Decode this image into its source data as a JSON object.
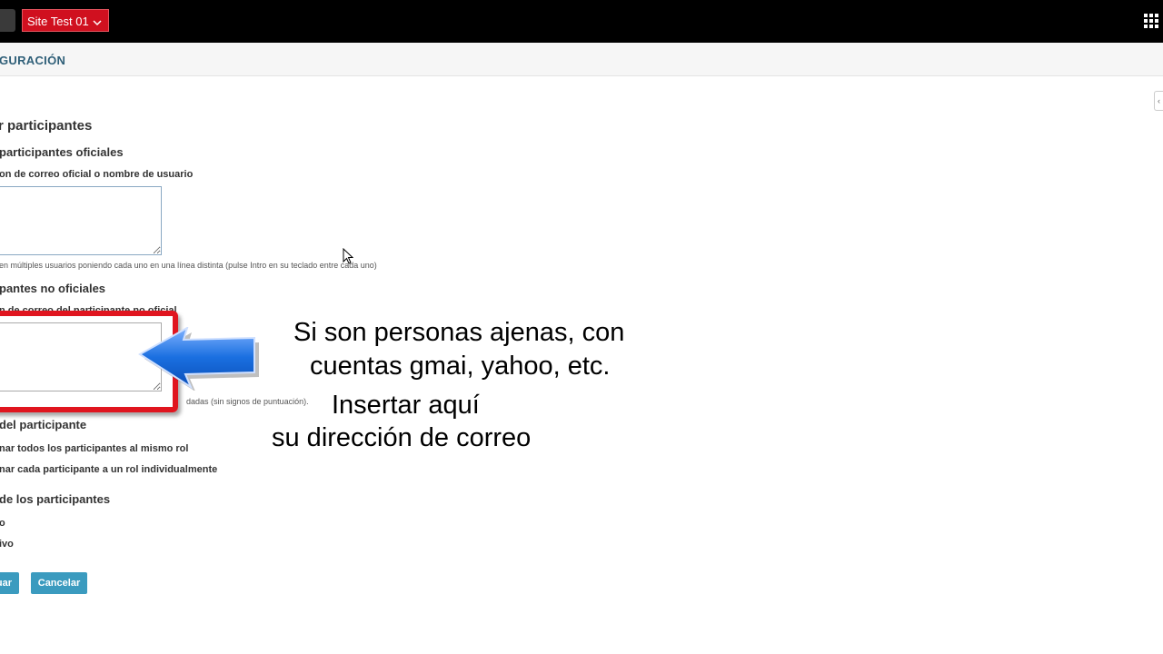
{
  "topbar": {
    "site_label": "Site Test 01",
    "site_chevron_icon": "chevron-down-icon",
    "apps_icon": "grid-icon"
  },
  "subbar": {
    "title": "GURACIÓN"
  },
  "side_toggle_glyph": "‹",
  "form": {
    "heading": "r participantes",
    "official": {
      "heading": "participantes oficiales",
      "label": "on de correo oficial o nombre de usuario",
      "help": "en múltiples usuarios poniendo cada uno en una línea distinta (pulse Intro en su teclado entre cada uno)",
      "value": ""
    },
    "unofficial": {
      "heading": "pantes no oficiales",
      "label": "n de correo del participante no oficial",
      "help": "dadas (sin signos de puntuación).",
      "value": ""
    },
    "role": {
      "heading": "del participante",
      "option_same": "nar todos los participantes al mismo rol",
      "option_individual": "nar cada participante a un rol individualmente"
    },
    "status": {
      "heading": "de los participantes",
      "option_active": "o",
      "option_inactive": "ivo"
    },
    "buttons": {
      "continue": "uar",
      "cancel": "Cancelar"
    }
  },
  "annotation": {
    "line1": "Si son personas ajenas, con",
    "line2": "cuentas gmai, yahoo, etc.",
    "line3": "Insertar aquí",
    "line4": "su dirección de correo",
    "highlight_color": "#e0151f",
    "arrow_color": "#1a6fe0"
  },
  "colors": {
    "topbar": "#000000",
    "site_select": "#d0101f",
    "button": "#3b9bbf",
    "title": "#2f5f78"
  }
}
